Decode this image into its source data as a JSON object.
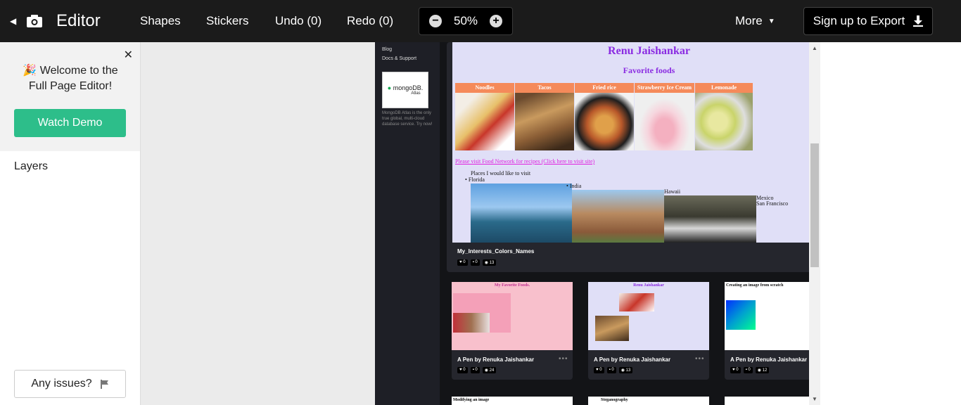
{
  "topbar": {
    "title": "Editor",
    "menu": [
      "Shapes",
      "Stickers",
      "Undo (0)",
      "Redo (0)"
    ],
    "zoom": "50%",
    "more": "More",
    "export": "Sign up to Export"
  },
  "sidebar": {
    "welcome_line1": "Welcome to the",
    "welcome_line2": "Full Page Editor!",
    "demo": "Watch Demo",
    "layers": "Layers",
    "issues": "Any issues?"
  },
  "site": {
    "nav": [
      "Blog",
      "Docs & Support"
    ],
    "ad_brand": "mongoDB.",
    "ad_sub": "Atlas",
    "ad_desc": "MongoDB Atlas is the only true global, multi-cloud database service. Try now!"
  },
  "main_pen": {
    "name": "Renu Jaishankar",
    "subtitle": "Favorite foods",
    "foods": [
      "Noodles",
      "Tacos",
      "Fried rice",
      "Strawberry Ice Cream",
      "Lemonade"
    ],
    "link": "Please visit Food Network for recipes (Click here to visit site)",
    "places_title": "Places I would like to visit",
    "places": [
      "Florida",
      "India",
      "Hawaii",
      "Mexico",
      "San Francisco"
    ],
    "title": "My_Interests_Colors_Names",
    "likes": "0",
    "comments": "0",
    "views": "13"
  },
  "cards": [
    {
      "preview_title": "My Favorite Foods.",
      "title": "A Pen by Renuka Jaishankar",
      "likes": "0",
      "comments": "0",
      "views": "24"
    },
    {
      "preview_title": "Renu Jaishankar",
      "title": "A Pen by Renuka Jaishankar",
      "likes": "0",
      "comments": "0",
      "views": "13"
    },
    {
      "preview_title": "Creating an image from scratch",
      "title": "A Pen by Renuka Jaishankar",
      "likes": "0",
      "comments": "0",
      "views": "12"
    }
  ],
  "bottom_cards": [
    "Modifying an image",
    "Steganography",
    ""
  ],
  "colors": {
    "accent": "#2dbe8a",
    "topbar": "#1b1b1b",
    "pen_bg": "#e0dff7",
    "purple": "#8a2be2"
  }
}
